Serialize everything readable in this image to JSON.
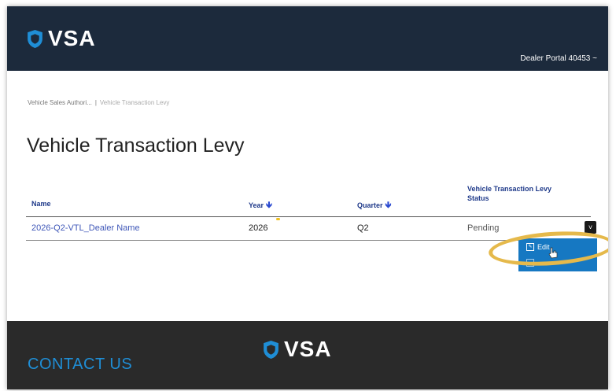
{
  "header": {
    "brand": "VSA",
    "portal_menu": "Dealer Portal 40453 ~"
  },
  "breadcrumb": {
    "root": "Vehicle Sales Authori...",
    "separator": "|",
    "current": "Vehicle Transaction Levy"
  },
  "page": {
    "title": "Vehicle Transaction Levy"
  },
  "table": {
    "columns": {
      "name": "Name",
      "year": "Year",
      "quarter": "Quarter",
      "status_line1": "Vehicle Transaction Levy",
      "status_line2": "Status"
    },
    "rows": [
      {
        "name": "2026-Q2-VTL_Dealer Name",
        "year": "2026",
        "quarter": "Q2",
        "status": "Pending"
      }
    ]
  },
  "row_menu": {
    "edit_label": "Edit"
  },
  "footer": {
    "contact": "CONTACT US",
    "brand": "VSA"
  },
  "colors": {
    "header_bg": "#1c2a3c",
    "accent_blue": "#1f8ed6",
    "link": "#3f57b8",
    "highlight": "#e5b94b",
    "menu_bg": "#1678c2"
  }
}
